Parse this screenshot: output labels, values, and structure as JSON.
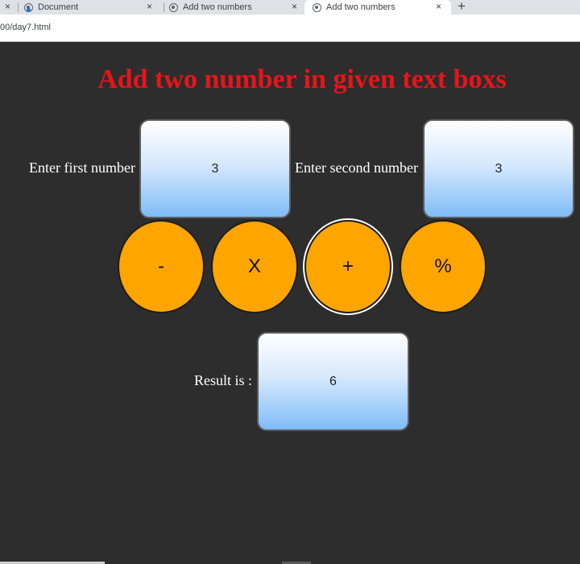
{
  "browser": {
    "tabs": [
      {
        "title": "Document",
        "close": "×"
      },
      {
        "title": "Add two numbers",
        "close": "×"
      },
      {
        "title": "Add two numbers",
        "close": "×",
        "active": true
      }
    ],
    "leading_close": "×",
    "new_tab": "+",
    "url": "00/day7.html"
  },
  "page": {
    "title": "Add two number in given text boxs",
    "first_label": "Enter first number",
    "first_value": "3",
    "second_label": "Enter second number",
    "second_value": "3",
    "operators": [
      {
        "symbol": "-"
      },
      {
        "symbol": "X"
      },
      {
        "symbol": "+",
        "focused": true
      },
      {
        "symbol": "%"
      }
    ],
    "result_label": "Result is :",
    "result_value": "6"
  },
  "colors": {
    "background": "#2d2d2d",
    "title": "#e8141a",
    "button": "#ffa500",
    "input_top": "#ffffff",
    "input_bottom": "#7fbcf8"
  }
}
